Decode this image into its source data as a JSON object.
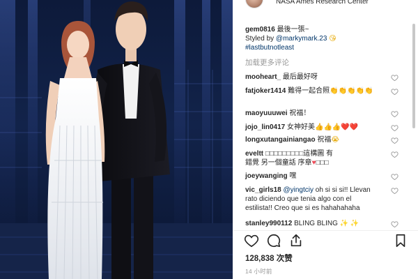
{
  "header": {
    "location": "NASA Ames Research Center"
  },
  "caption": {
    "user": "gem0816",
    "text": "最後一張~",
    "line2_prefix": "Styled by",
    "line2_mention": "@markymark.23",
    "line2_emoji": "😘",
    "hashtag": "#lastbutnotleast"
  },
  "load_more": "加载更多评论",
  "comments": [
    {
      "user": "mooheart_",
      "text": "最后最好呀"
    },
    {
      "user": "fatjoker1414",
      "text": "難得一起合照",
      "emoji": "👏👏👏👏👏"
    },
    {
      "user": "maoyuuuwei",
      "text": "祝福！"
    },
    {
      "user": "jojo_lin0417",
      "text": "女神好美",
      "emoji": "👍👍👍",
      "hearts": "❤️❤️"
    },
    {
      "user": "longxutangainiangao",
      "text": "祝福",
      "emoji": "😭"
    },
    {
      "user": "eveltt",
      "text": "□□□□□□□□□這構圖 有",
      "line2": "錯覺 另一個童話 序章",
      "line2_tail": "□□□",
      "heart": "♥"
    },
    {
      "user": "joeywanging",
      "text": "嘿"
    },
    {
      "user": "vic_girls18",
      "mention": "@yingtciy",
      "text": "oh si si si!! Llevan",
      "line2": "rato diciendo que tenia algo con el",
      "line3": "estilista!! Creo que si es hahahahaha"
    },
    {
      "user": "stanley990112",
      "text": "BLING BLING",
      "emoji": "✨ ✨"
    }
  ],
  "likes": {
    "count": "128,838",
    "unit": "次赞"
  },
  "time": "14 小时前",
  "colors": {
    "link": "#003569",
    "text": "#262626",
    "muted": "#999999",
    "heart": "#ed4956"
  },
  "icons": [
    "heart-icon",
    "comment-icon",
    "share-icon",
    "bookmark-icon"
  ]
}
